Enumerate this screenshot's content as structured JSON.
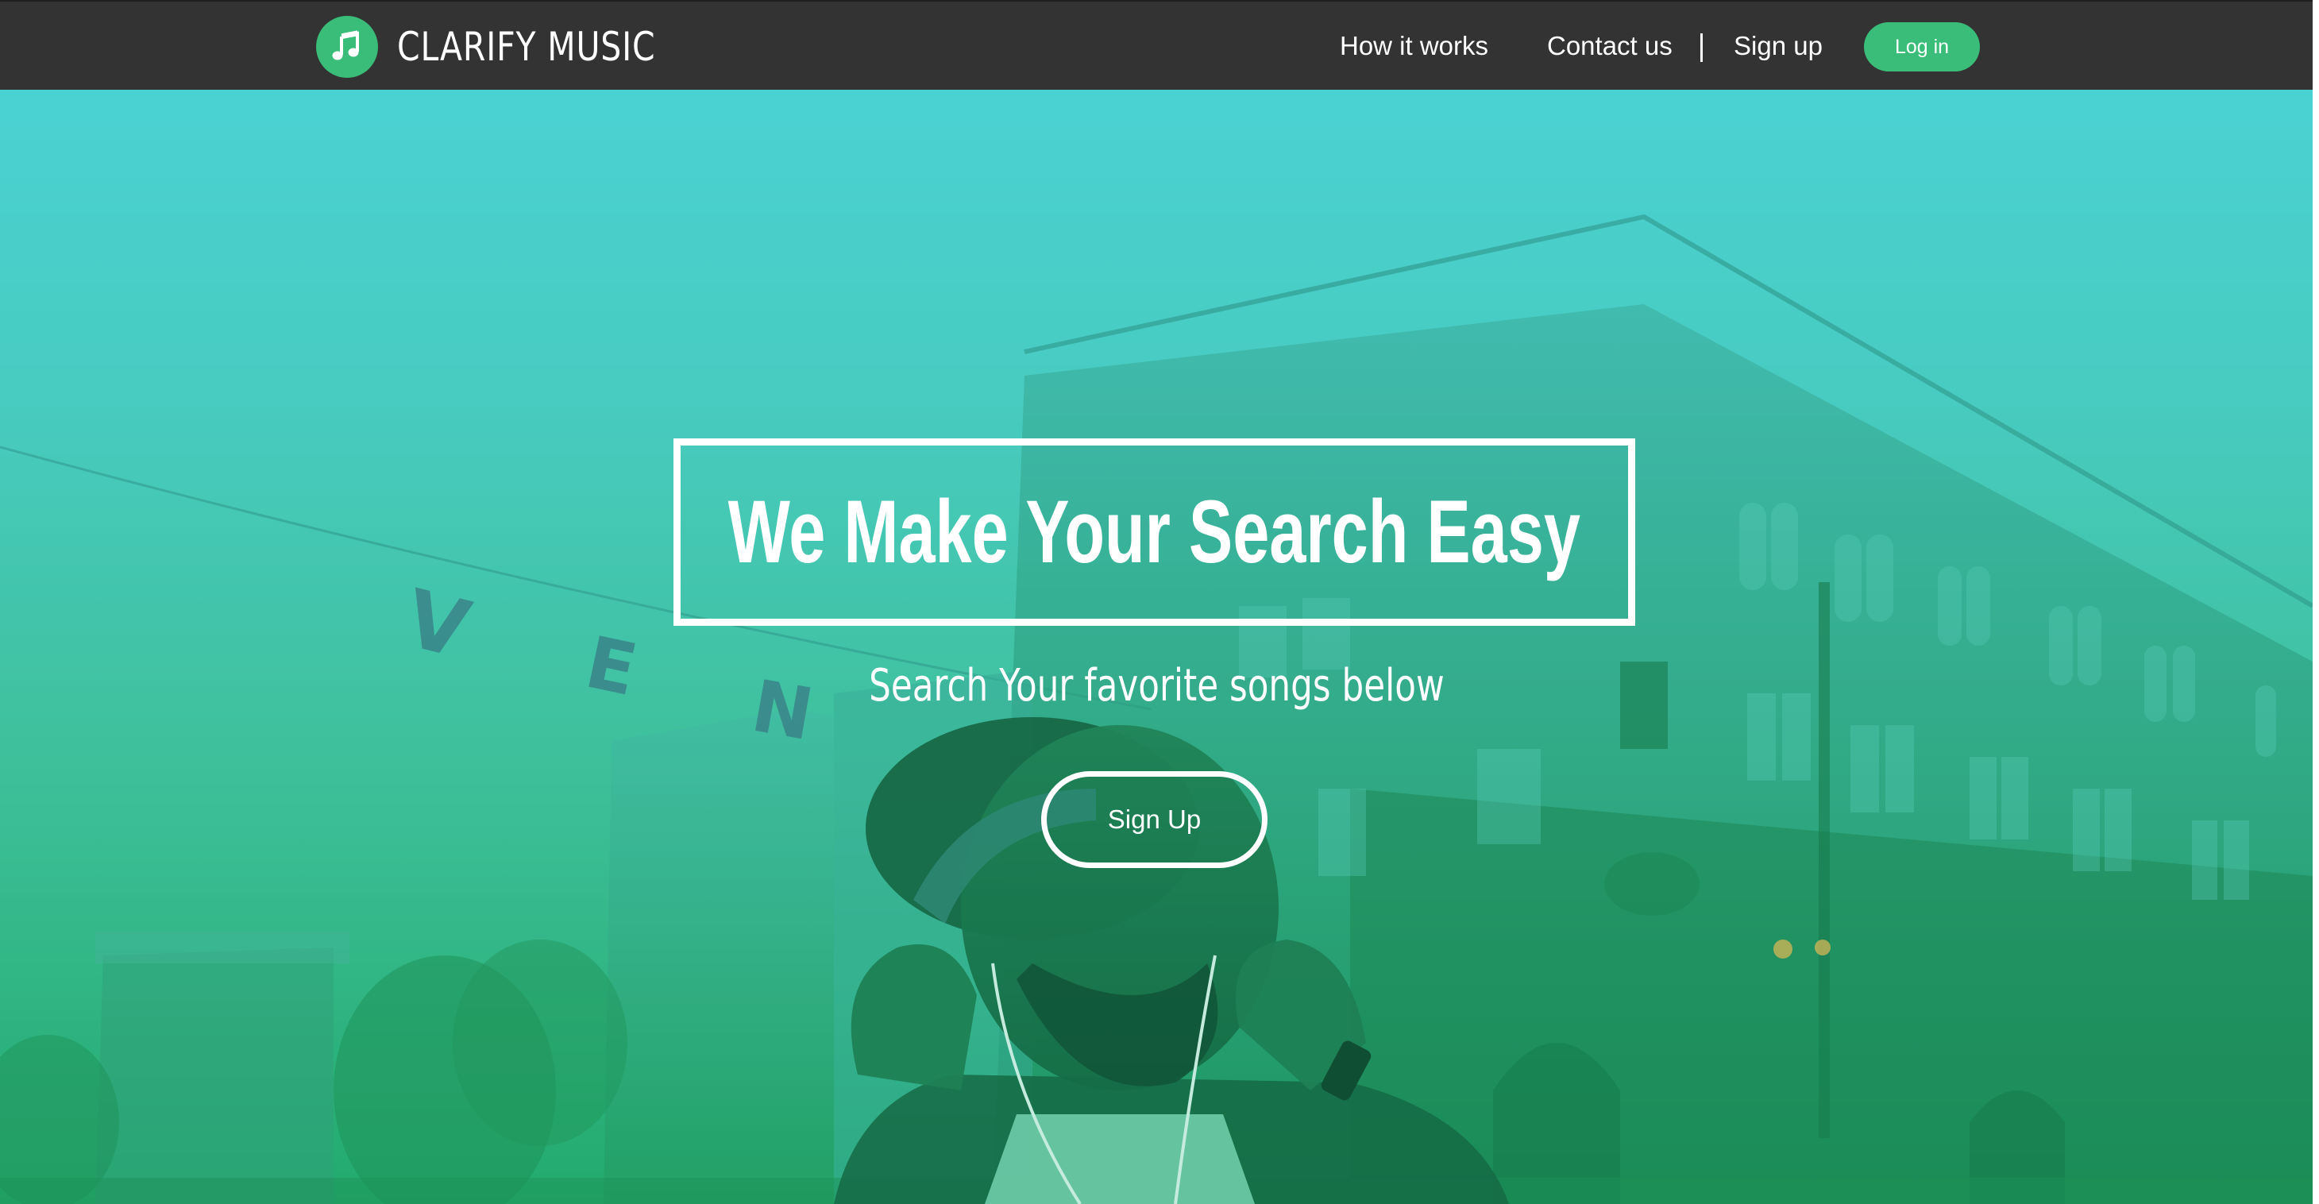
{
  "brand": {
    "name": "CLARIFY MUSIC",
    "logo_icon": "music-note-icon",
    "logo_color": "#39bd78"
  },
  "nav": {
    "how_it_works": "How it works",
    "contact_us": "Contact us",
    "sign_up": "Sign up",
    "log_in": "Log in"
  },
  "hero": {
    "headline": "We Make Your Search Easy",
    "subheadline": "Search Your favorite songs below",
    "cta_label": "Sign Up",
    "sign_letters": "V E N",
    "overlay_colors": [
      "#4ed5dc",
      "#3fbf98",
      "#20a765"
    ]
  },
  "colors": {
    "header_bg": "#333333",
    "accent": "#39bd78",
    "text": "#ffffff"
  }
}
